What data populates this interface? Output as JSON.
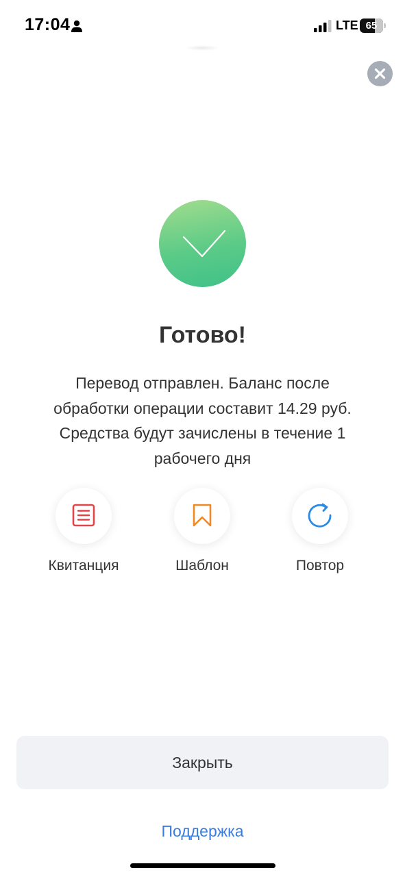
{
  "status_bar": {
    "time": "17:04",
    "network": "LTE",
    "battery_level": "65",
    "signal_bars_active": 3,
    "signal_bars_total": 4
  },
  "icons": {
    "person": "person-icon",
    "signal": "cellular-signal-icon",
    "battery": "battery-icon",
    "close": "close-icon",
    "success": "checkmark-icon",
    "receipt": "receipt-icon",
    "template": "bookmark-icon",
    "repeat": "repeat-icon"
  },
  "result": {
    "title": "Готово!",
    "lines": [
      "Перевод отправлен. Баланс после",
      "обработки операции составит 14.29 руб.",
      "Средства будут зачислены в течение 1",
      "рабочего дня"
    ]
  },
  "actions": [
    {
      "label": "Квитанция",
      "icon": "receipt-icon",
      "color": "#e0454a"
    },
    {
      "label": "Шаблон",
      "icon": "bookmark-icon",
      "color": "#f08a24"
    },
    {
      "label": "Повтор",
      "icon": "repeat-icon",
      "color": "#2a8ae4"
    }
  ],
  "footer": {
    "close_label": "Закрыть",
    "support_label": "Поддержка"
  },
  "colors": {
    "success_gradient_top": "#a2dc8e",
    "success_gradient_bottom": "#3fc189",
    "close_circle": "#a6adb6",
    "link": "#3a7de0",
    "button_bg": "#f1f2f6",
    "text": "#333333"
  }
}
